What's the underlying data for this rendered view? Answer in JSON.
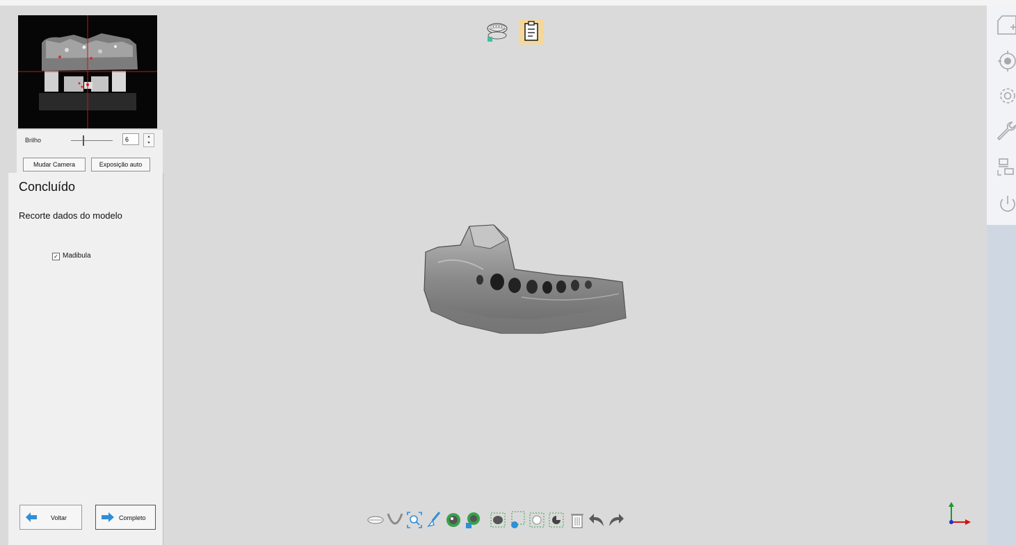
{
  "camera": {
    "brightness_label": "Brilho",
    "brightness_value": "6",
    "brightness_level": 0.3,
    "switch_camera_label": "Mudar Camera",
    "auto_exposure_label": "Exposição auto"
  },
  "panel": {
    "title": "Concluído",
    "subtitle": "Recorte dados do modelo",
    "checkbox_label": "Madibula",
    "checkbox_checked": true,
    "back_label": "Voltar",
    "complete_label": "Completo"
  },
  "top_icons": [
    "dental-arch-scan-icon",
    "clipboard-report-icon"
  ],
  "right_toolbar": [
    "new-file-icon",
    "target-icon",
    "settings-gear-icon",
    "wrench-icon",
    "dual-monitor-icon",
    "power-icon"
  ],
  "bottom_toolbar": [
    "upper-arch-icon",
    "lower-arch-icon",
    "zoom-fit-icon",
    "brush-icon",
    "select-lasso-icon",
    "deselect-lasso-icon",
    "select-area-icon",
    "deselect-area-icon",
    "select-region-icon",
    "invert-region-icon",
    "delete-icon",
    "undo-icon",
    "redo-icon"
  ],
  "colors": {
    "viewport_bg": "#dadada",
    "panel_bg": "#f0f0f0",
    "accent_blue": "#2f8ed8",
    "crosshair_red": "#d01010"
  }
}
